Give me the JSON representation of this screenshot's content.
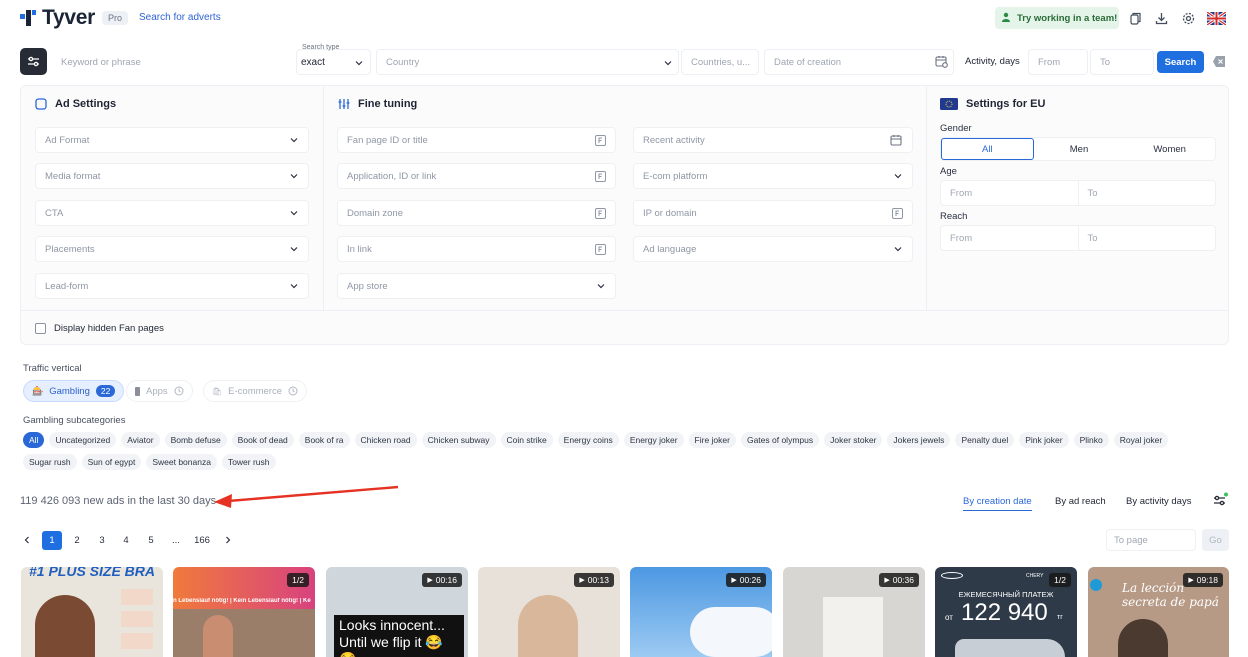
{
  "header": {
    "brand": "Tyver",
    "badge": "Pro",
    "search_link": "Search for adverts",
    "team_button": "Try working in a team!"
  },
  "search": {
    "keyword_placeholder": "Keyword or phrase",
    "search_type_label": "Search type",
    "search_type_value": "exact",
    "country_placeholder": "Country",
    "countries_placeholder": "Countries, u...",
    "date_placeholder": "Date of creation",
    "activity_label": "Activity, days",
    "from_placeholder": "From",
    "to_placeholder": "To",
    "search_button": "Search"
  },
  "ad_settings": {
    "title": "Ad Settings",
    "fields": [
      "Ad Format",
      "Media format",
      "CTA",
      "Placements",
      "Lead-form"
    ]
  },
  "fine_tuning": {
    "title": "Fine tuning",
    "col1": [
      "Fan page ID or title",
      "Application, ID or link",
      "Domain zone",
      "In link",
      "App store"
    ],
    "col2": [
      "Recent activity",
      "E-com platform",
      "IP or domain",
      "Ad language"
    ]
  },
  "eu_settings": {
    "title": "Settings for EU",
    "gender_label": "Gender",
    "gender_options": [
      "All",
      "Men",
      "Women"
    ],
    "age_label": "Age",
    "reach_label": "Reach",
    "from": "From",
    "to": "To"
  },
  "hidden_fanpages": "Display hidden Fan pages",
  "traffic_vertical": {
    "label": "Traffic vertical",
    "items": [
      {
        "label": "Gambling",
        "count": "22"
      },
      {
        "label": "Apps"
      },
      {
        "label": "E-commerce"
      }
    ]
  },
  "subcategories": {
    "label": "Gambling subcategories",
    "items": [
      "All",
      "Uncategorized",
      "Aviator",
      "Bomb defuse",
      "Book of dead",
      "Book of ra",
      "Chicken road",
      "Chicken subway",
      "Coin strike",
      "Energy coins",
      "Energy joker",
      "Fire joker",
      "Gates of olympus",
      "Joker stoker",
      "Jokers jewels",
      "Penalty duel",
      "Pink joker",
      "Plinko",
      "Royal joker",
      "Sugar rush",
      "Sun of egypt",
      "Sweet bonanza",
      "Tower rush"
    ]
  },
  "stats": "119 426 093 new ads in the last 30 days",
  "sort": [
    "By creation date",
    "By ad reach",
    "By activity days"
  ],
  "pagination": {
    "pages": [
      "1",
      "2",
      "3",
      "4",
      "5",
      "...",
      "166"
    ],
    "to_page_placeholder": "To page",
    "go": "Go"
  },
  "cards": [
    {
      "badge": "",
      "text": "#1 PLUS SIZE BRA",
      "bg": "#e9e4dc"
    },
    {
      "badge": "1/2",
      "text": "n Lebenslauf nötig! | Kein Lebenslauf nötig! | Ke",
      "bg": "#f07a3c"
    },
    {
      "badge": "00:16",
      "text": "Looks innocent... Until we flip it 😂😂",
      "bg": "#cfd6dc"
    },
    {
      "badge": "00:13",
      "text": "",
      "bg": "#e8e1d9"
    },
    {
      "badge": "00:26",
      "text": "",
      "bg": "#5fa5e6"
    },
    {
      "badge": "00:36",
      "text": "",
      "bg": "#d8d6d2"
    },
    {
      "badge": "1/2",
      "text": "ЕЖЕМЕСЯЧНЫЙ ПЛАТЕЖ",
      "price": "122 940",
      "prefix": "от",
      "cur": "тг",
      "carlabel": "CHERY",
      "bg": "#2f3a48"
    },
    {
      "badge": "09:18",
      "text": "La lección secreta de papá",
      "bg": "#b79a86"
    }
  ]
}
